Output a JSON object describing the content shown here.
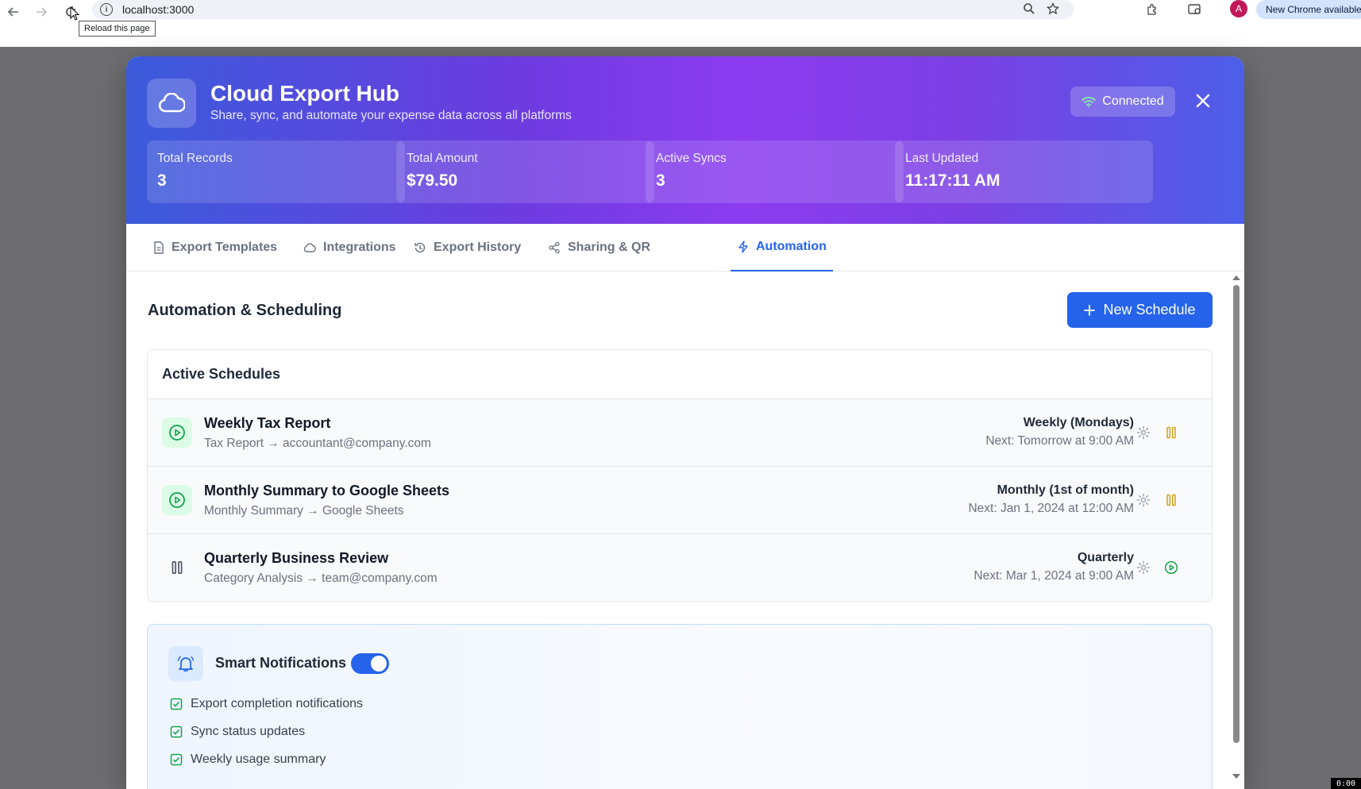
{
  "browser": {
    "url": "localhost:3000",
    "tooltip": "Reload this page",
    "update_label": "New Chrome available",
    "profile_initial": "A"
  },
  "hero": {
    "title": "Cloud Export Hub",
    "subtitle": "Share, sync, and automate your expense data across all platforms",
    "status": "Connected",
    "stats": [
      {
        "label": "Total Records",
        "value": "3"
      },
      {
        "label": "Total Amount",
        "value": "$79.50"
      },
      {
        "label": "Active Syncs",
        "value": "3"
      },
      {
        "label": "Last Updated",
        "value": "11:17:11 AM"
      }
    ]
  },
  "tabs": [
    {
      "label": "Export Templates",
      "icon": "document-icon",
      "active": false
    },
    {
      "label": "Integrations",
      "icon": "cloud-icon",
      "active": false
    },
    {
      "label": "Export History",
      "icon": "history-icon",
      "active": false
    },
    {
      "label": "Sharing & QR",
      "icon": "share-icon",
      "active": false
    },
    {
      "label": "Automation",
      "icon": "lightning-icon",
      "active": true
    }
  ],
  "automation": {
    "title": "Automation & Scheduling",
    "new_button": "New Schedule",
    "schedules_title": "Active Schedules",
    "schedules": [
      {
        "name": "Weekly Tax Report",
        "desc": "Tax Report → accountant@company.com",
        "freq": "Weekly (Mondays)",
        "next": "Next: Tomorrow at 9:00 AM",
        "status": "active"
      },
      {
        "name": "Monthly Summary to Google Sheets",
        "desc": "Monthly Summary → Google Sheets",
        "freq": "Monthly (1st of month)",
        "next": "Next: Jan 1, 2024 at 12:00 AM",
        "status": "active"
      },
      {
        "name": "Quarterly Business Review",
        "desc": "Category Analysis → team@company.com",
        "freq": "Quarterly",
        "next": "Next: Mar 1, 2024 at 9:00 AM",
        "status": "paused"
      }
    ]
  },
  "notifications": {
    "title": "Smart Notifications",
    "enabled": true,
    "items": [
      "Export completion notifications",
      "Sync status updates",
      "Weekly usage summary"
    ]
  },
  "clock": "0:00",
  "colors": {
    "accent": "#2563eb",
    "success": "#16a34a",
    "warning": "#d4a017"
  }
}
